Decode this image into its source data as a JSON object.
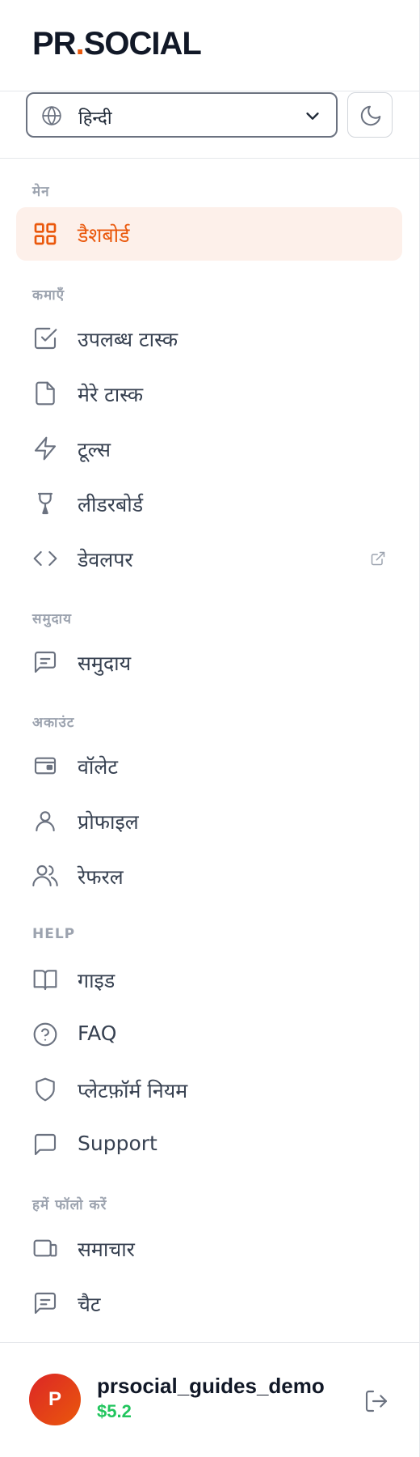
{
  "brand": {
    "prefix": "PR",
    "dot": ".",
    "suffix": "SOCIAL"
  },
  "language_select": {
    "value": "हिन्दी",
    "icon": "globe-icon"
  },
  "theme_toggle": {
    "icon": "moon-icon"
  },
  "sections": {
    "main": "मेन",
    "earn": "कमाएँ",
    "community": "समुदाय",
    "account": "अकाउंट",
    "help": "HELP",
    "follow": "हमें फॉलो करें"
  },
  "nav": {
    "dashboard": "डैशबोर्ड",
    "available_tasks": "उपलब्ध टास्क",
    "my_tasks": "मेरे टास्क",
    "tools": "टूल्स",
    "leaderboard": "लीडरबोर्ड",
    "developer": "डेवलपर",
    "community": "समुदाय",
    "wallet": "वॉलेट",
    "profile": "प्रोफाइल",
    "referral": "रेफरल",
    "guide": "गाइड",
    "faq": "FAQ",
    "platform_rules": "प्लेटफ़ॉर्म नियम",
    "support": "Support",
    "news": "समाचार",
    "chat": "चैट"
  },
  "user": {
    "initial": "P",
    "name": "prsocial_guides_demo",
    "balance": "$5.2"
  },
  "colors": {
    "accent": "#ea580c",
    "active_bg": "#fdf0ea",
    "balance": "#22c55e"
  }
}
